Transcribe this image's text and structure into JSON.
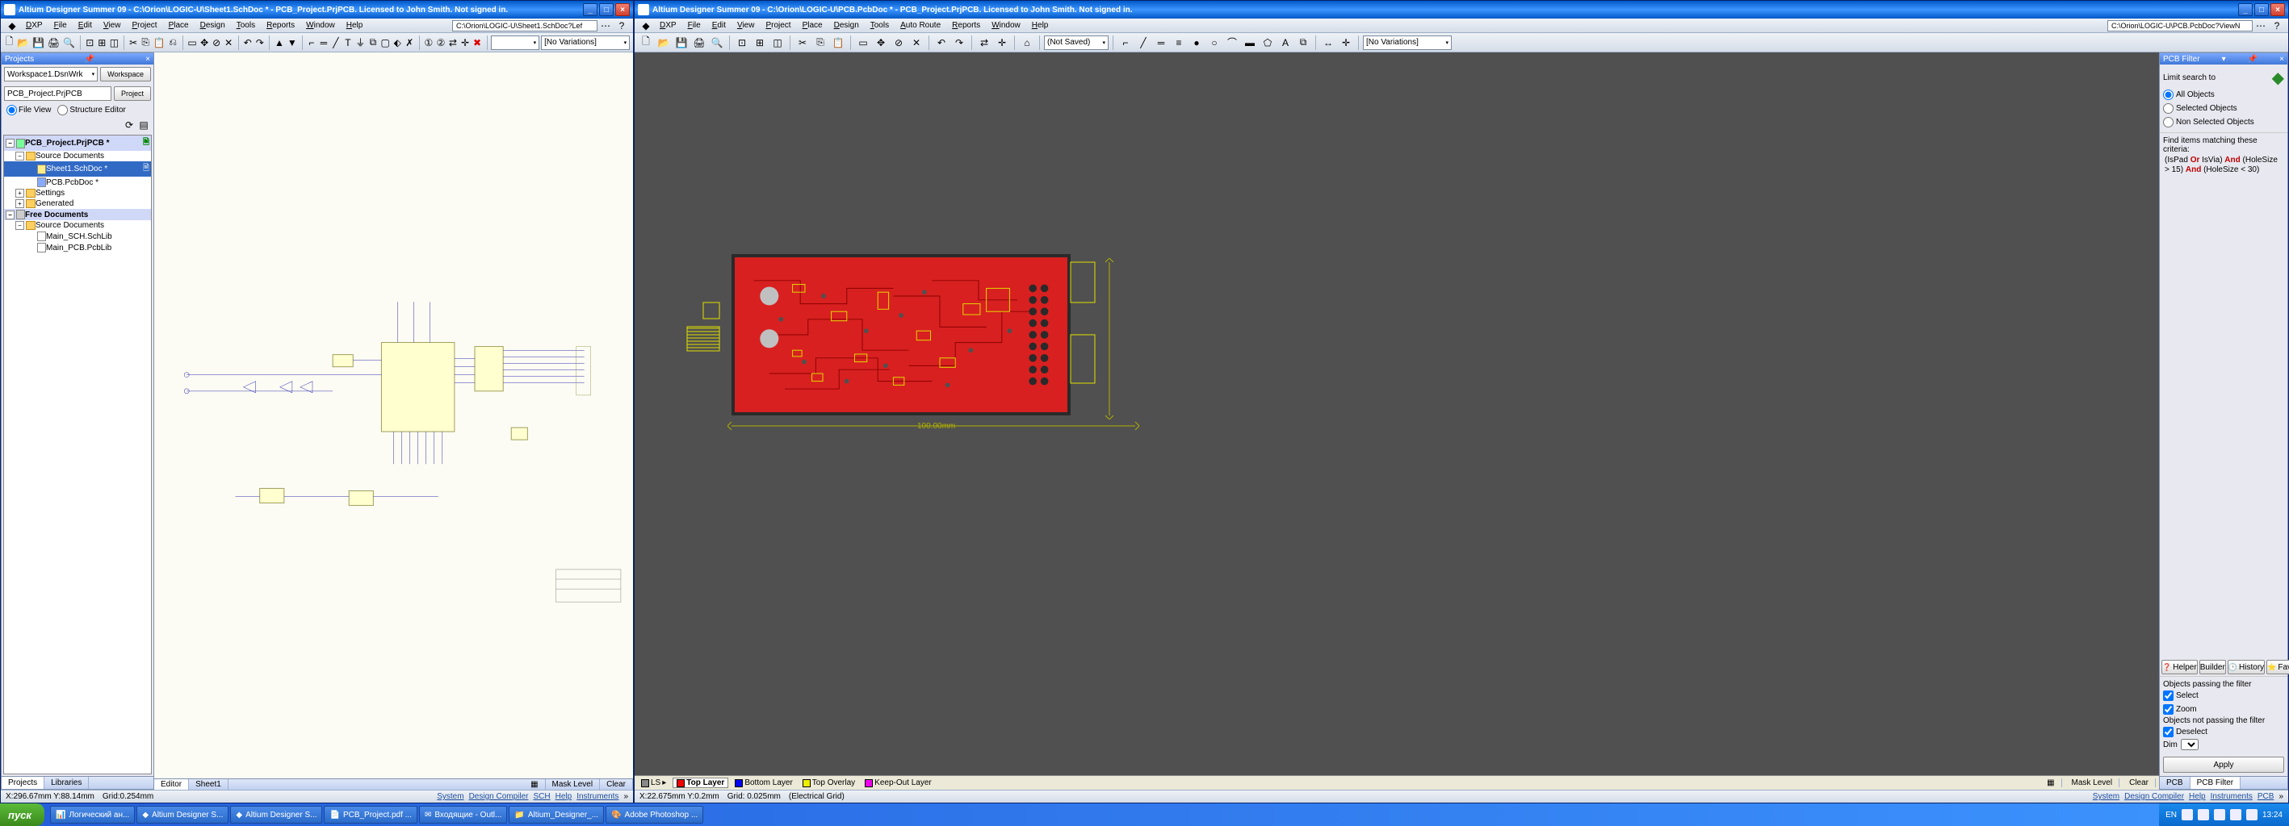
{
  "taskbar": {
    "start": "пуск",
    "items": [
      "Логический ан...",
      "Altium Designer S...",
      "Altium Designer S...",
      "PCB_Project.pdf ...",
      "Входящие - Outl...",
      "Altium_Designer_...",
      "Adobe Photoshop ..."
    ],
    "lang": "EN",
    "time": "13:24"
  },
  "left": {
    "title": "Altium Designer Summer 09 - C:\\Orion\\LOGIC-U\\Sheet1.SchDoc * - PCB_Project.PrjPCB. Licensed to John Smith. Not signed in.",
    "docpath": "C:\\Orion\\LOGIC-U\\Sheet1.SchDoc?Lef",
    "menus": [
      "DXP",
      "File",
      "Edit",
      "View",
      "Project",
      "Place",
      "Design",
      "Tools",
      "Reports",
      "Window",
      "Help"
    ],
    "variations": "[No Variations]",
    "panel": {
      "title": "Projects",
      "workspace": "Workspace1.DsnWrk",
      "workspace_btn": "Workspace",
      "project": "PCB_Project.PrjPCB",
      "project_btn": "Project",
      "view_file": "File View",
      "view_struct": "Structure Editor",
      "tree": {
        "root": "PCB_Project.PrjPCB *",
        "src": "Source Documents",
        "sheet": "Sheet1.SchDoc *",
        "pcb": "PCB.PcbDoc *",
        "settings": "Settings",
        "gen": "Generated",
        "free": "Free Documents",
        "src2": "Source Documents",
        "schlib": "Main_SCH.SchLib",
        "pcblib": "Main_PCB.PcbLib"
      }
    },
    "tabs": {
      "projects": "Projects",
      "libraries": "Libraries"
    },
    "editor_tabs": {
      "editor": "Editor",
      "sheet": "Sheet1"
    },
    "status": {
      "coords": "X:296.67mm Y:88.14mm",
      "grid": "Grid:0.254mm",
      "links": [
        "System",
        "Design Compiler",
        "SCH",
        "Help",
        "Instruments"
      ],
      "mask": "Mask Level",
      "clear": "Clear"
    }
  },
  "right": {
    "title": "Altium Designer Summer 09 - C:\\Orion\\LOGIC-U\\PCB.PcbDoc * - PCB_Project.PrjPCB. Licensed to John Smith. Not signed in.",
    "docpath": "C:\\Orion\\LOGIC-U\\PCB.PcbDoc?ViewN",
    "menus": [
      "DXP",
      "File",
      "Edit",
      "View",
      "Project",
      "Place",
      "Design",
      "Tools",
      "Auto Route",
      "Reports",
      "Window",
      "Help"
    ],
    "variations": "[No Variations]",
    "notsaved": "(Not Saved)",
    "dim_w": "100.00mm",
    "layers": {
      "ls": "LS",
      "top": "Top Layer",
      "bot": "Bottom Layer",
      "ovl": "Top Overlay",
      "keep": "Keep-Out Layer"
    },
    "filter": {
      "title": "PCB Filter",
      "limit": "Limit search to",
      "all": "All Objects",
      "sel": "Selected Objects",
      "nonsel": "Non Selected Objects",
      "find": "Find items matching these criteria:",
      "expr_p1": "(IsPad ",
      "expr_or": "Or",
      "expr_p2": " IsVia) ",
      "expr_and1": "And",
      "expr_p3": " (HoleSize > 15) ",
      "expr_and2": "And",
      "expr_p4": " (HoleSize < 30)",
      "tabs": {
        "helper": "Helper",
        "builder": "Builder",
        "history": "History",
        "fav": "Favorites"
      },
      "pass": "Objects passing the filter",
      "cb_sel": "Select",
      "cb_zoom": "Zoom",
      "npass": "Objects not passing the filter",
      "cb_desel": "Deselect",
      "dim": "Dim",
      "apply": "Apply"
    },
    "status": {
      "coords": "X:22.675mm Y:0.2mm",
      "grid": "Grid: 0.025mm",
      "egrid": "(Electrical Grid)",
      "links": [
        "System",
        "Design Compiler",
        "Help",
        "Instruments",
        "PCB"
      ],
      "mask": "Mask Level",
      "clear": "Clear"
    },
    "bottomtabs": {
      "pcb": "PCB",
      "filter": "PCB Filter"
    }
  }
}
